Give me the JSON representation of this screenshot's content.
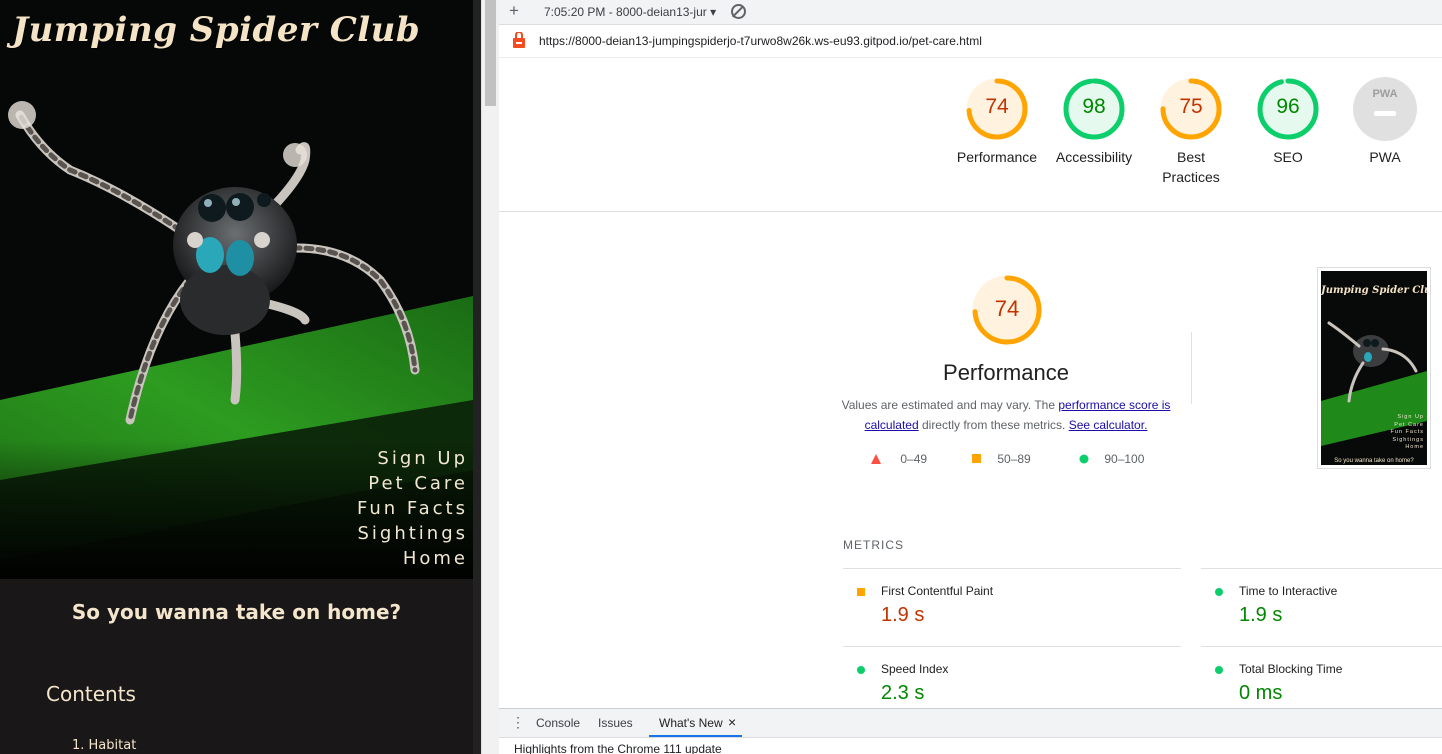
{
  "site": {
    "title": "Jumping Spider Club",
    "nav": [
      "Sign Up",
      "Pet Care",
      "Fun Facts",
      "Sightings",
      "Home"
    ],
    "heading": "So you wanna take on home?",
    "contents_heading": "Contents",
    "contents_items": [
      "1. Habitat"
    ]
  },
  "devtools": {
    "toolbar": {
      "add_label": "+",
      "report_select": "7:05:20 PM - 8000-deian13-jur ▾"
    },
    "url": "https://8000-deian13-jumpingspiderjo-t7urwo8w26k.ws-eu93.gitpod.io/pet-care.html",
    "scores": [
      {
        "label": "Performance",
        "value": "74",
        "status": "average"
      },
      {
        "label": "Accessibility",
        "value": "98",
        "status": "pass"
      },
      {
        "label": "Best Practices",
        "value": "75",
        "status": "average"
      },
      {
        "label": "SEO",
        "value": "96",
        "status": "pass"
      },
      {
        "label": "PWA",
        "value": "PWA",
        "status": "na"
      }
    ],
    "performance": {
      "score": "74",
      "title": "Performance",
      "desc_prefix": "Values are estimated and may vary. The ",
      "desc_link1": "performance score is calculated",
      "desc_middle": " directly from these metrics. ",
      "desc_link2": "See calculator."
    },
    "legend": [
      "0–49",
      "50–89",
      "90–100"
    ],
    "thumbnail": {
      "title": "Jumping Spider Club",
      "nav": [
        "Sign Up",
        "Pet Care",
        "Fun Facts",
        "Sightings",
        "Home"
      ],
      "caption": "So you wanna take on home?"
    },
    "metrics_heading": "METRICS",
    "metrics": [
      {
        "name": "First Contentful Paint",
        "value": "1.9 s",
        "status": "average"
      },
      {
        "name": "Time to Interactive",
        "value": "1.9 s",
        "status": "pass"
      },
      {
        "name": "Speed Index",
        "value": "2.3 s",
        "status": "pass"
      },
      {
        "name": "Total Blocking Time",
        "value": "0 ms",
        "status": "pass"
      }
    ],
    "drawer": {
      "tabs": [
        "Console",
        "Issues",
        "What's New"
      ],
      "close": "×",
      "body": "Highlights from the Chrome 111 update"
    }
  },
  "colors": {
    "pass": "#0cce6b",
    "pass_text": "#008800",
    "average": "#ffa400",
    "average_text": "#c33300",
    "fail": "#ff4e42",
    "link": "#1a0dab",
    "accent": "#1a73e8"
  }
}
